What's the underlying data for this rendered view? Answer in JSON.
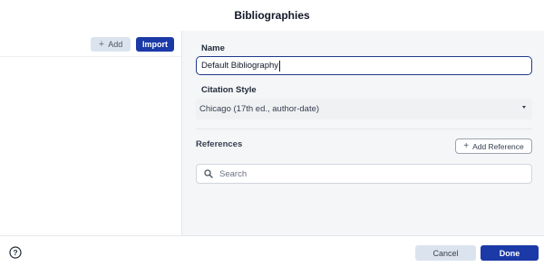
{
  "dialog": {
    "title": "Bibliographies"
  },
  "left_pane": {
    "add_label": "Add",
    "import_label": "Import"
  },
  "form": {
    "name_label": "Name",
    "name_value": "Default Bibliography",
    "citation_style_label": "Citation Style",
    "citation_style_value": "Chicago (17th ed., author-date)",
    "references_title": "References",
    "add_reference_label": "Add Reference",
    "search_placeholder": "Search"
  },
  "footer": {
    "cancel_label": "Cancel",
    "done_label": "Done"
  },
  "icons": {
    "add": "plus-icon",
    "add_reference": "plus-icon",
    "search": "search-icon",
    "dropdown": "chevron-down-icon",
    "help": "help-circle-icon"
  },
  "colors": {
    "primary": "#1b3aa8",
    "secondary_button": "#dbe4ee",
    "focus_border": "#1e3a8a",
    "panel_background": "#f5f6f8"
  }
}
